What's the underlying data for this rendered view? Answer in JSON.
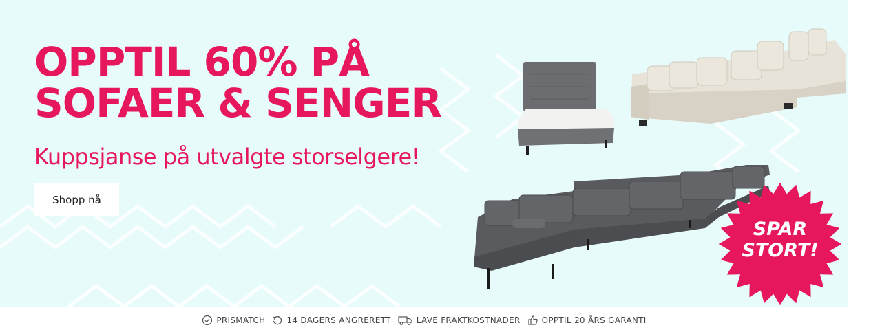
{
  "hero": {
    "headline_line1": "OPPTIL 60% PÅ",
    "headline_line2": "SOFAER & SENGER",
    "subline": "Kuppsjanse på utvalgte storselgere!",
    "cta_label": "Shopp nå",
    "badge_line1": "SPAR",
    "badge_line2": "STORT!",
    "accent_color": "#e6175c",
    "background_color": "#e8fbfb",
    "products": [
      "grey-continental-bed",
      "beige-u-sofa",
      "dark-grey-u-sofa"
    ]
  },
  "usps": [
    {
      "icon": "check-circle-icon",
      "label": "PRISMATCH"
    },
    {
      "icon": "return-arrow-icon",
      "label": "14 DAGERS ANGRERETT"
    },
    {
      "icon": "truck-icon",
      "label": "LAVE FRAKTKOSTNADER"
    },
    {
      "icon": "thumbs-up-icon",
      "label": "OPPTIL 20 ÅRS GARANTI"
    }
  ]
}
